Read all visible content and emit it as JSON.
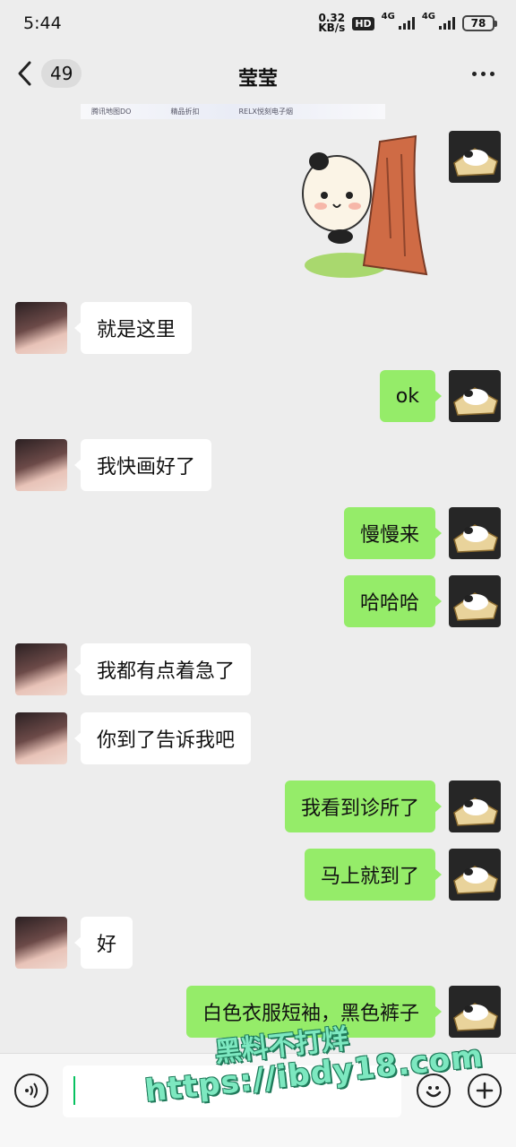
{
  "status_bar": {
    "time": "5:44",
    "speed_value": "0.32",
    "speed_unit": "KB/s",
    "hd_badge": "HD",
    "net1": "4G",
    "net2": "4G",
    "battery": "78"
  },
  "header": {
    "title": "莹莹",
    "unread_count": "49"
  },
  "artifact_strip": {
    "items": [
      "腾讯地图DO",
      "精品折扣",
      "RELX悦刻电子烟"
    ]
  },
  "messages": [
    {
      "side": "right",
      "type": "sticker",
      "sticker_name": "panda-behind-tree-sticker"
    },
    {
      "side": "left",
      "text": "就是这里"
    },
    {
      "side": "right",
      "text": "ok"
    },
    {
      "side": "left",
      "text": "我快画好了"
    },
    {
      "side": "right",
      "text": "慢慢来"
    },
    {
      "side": "right",
      "text": "哈哈哈"
    },
    {
      "side": "left",
      "text": "我都有点着急了"
    },
    {
      "side": "left",
      "text": "你到了告诉我吧"
    },
    {
      "side": "right",
      "text": "我看到诊所了"
    },
    {
      "side": "right",
      "text": "马上就到了"
    },
    {
      "side": "left",
      "text": "好"
    },
    {
      "side": "right",
      "text": "白色衣服短袖，黑色裤子"
    }
  ],
  "input_bar": {
    "voice_icon": "voice-icon",
    "emoji_icon": "emoji-icon",
    "plus_icon": "plus-icon",
    "input_value": ""
  },
  "watermark": {
    "line1": "黑料不打烊",
    "line2": "https://ibdy18.com"
  },
  "colors": {
    "background": "#ededed",
    "my_bubble": "#95ec69",
    "their_bubble": "#ffffff",
    "caret": "#07c160"
  }
}
